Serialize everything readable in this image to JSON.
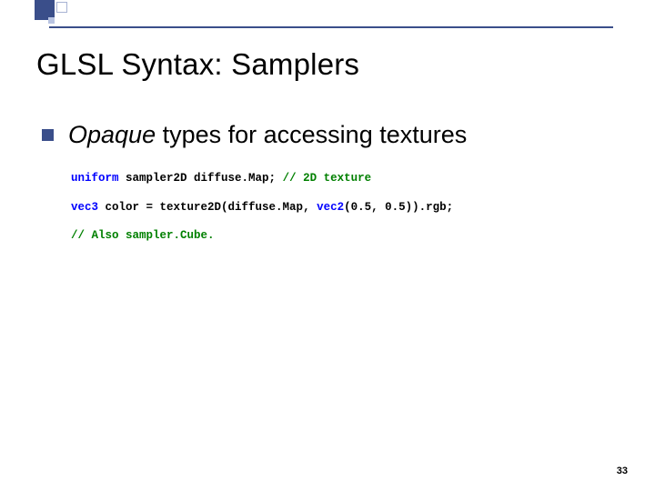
{
  "slide": {
    "title": "GLSL Syntax:  Samplers",
    "bullet": {
      "opaque": "Opaque",
      "rest": " types for accessing textures"
    },
    "code": {
      "l1a": "uniform",
      "l1b": " sampler2",
      "l1c": "D diffuse.Map; ",
      "l1d": "// 2",
      "l1e": "D texture",
      "l2a": "vec3",
      "l2b": " color = ",
      "l2c": "texture2",
      "l2d": "D(diffuse.Map, ",
      "l2e": "vec2",
      "l2f": "(0.5, 0.5)).",
      "l2g": "rgb;",
      "l3": "// Also sampler.Cube."
    },
    "page_number": "33"
  }
}
